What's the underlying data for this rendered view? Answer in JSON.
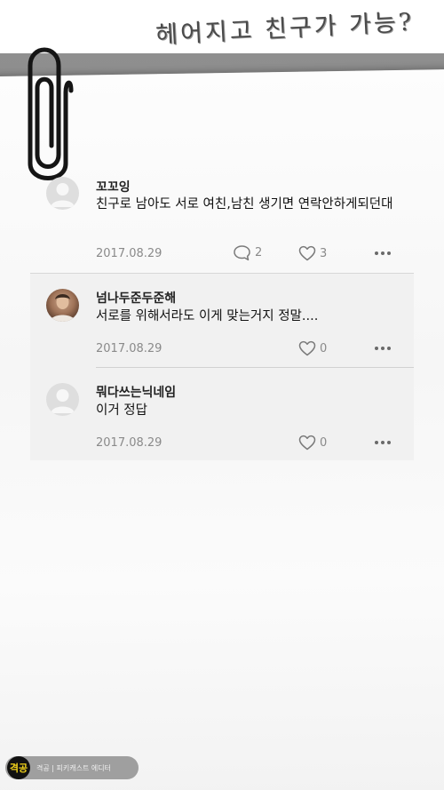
{
  "headline": "헤어지고 친구가 가능?",
  "comments": [
    {
      "username": "꼬꼬잉",
      "text": "친구로 남아도 서로 여친,남친 생기면 연락안하게되던대",
      "date": "2017.08.29",
      "reply_count": "2",
      "like_count": "3"
    },
    {
      "username": "넘나두준두준해",
      "text": "서로를 위해서라도 이게 맞는거지 정말....",
      "date": "2017.08.29",
      "like_count": "0"
    },
    {
      "username": "뭐다쓰는닉네임",
      "text": "이거 정답",
      "date": "2017.08.29",
      "like_count": "0"
    }
  ],
  "footer": {
    "logo": "격공",
    "text": "격공 | 피키캐스트 에디터"
  },
  "icons": {
    "reply": "speech-bubble-icon",
    "like": "heart-icon",
    "more": "more-dots-icon",
    "avatar_default": "default-avatar-icon",
    "decoration": "paperclip-icon"
  }
}
